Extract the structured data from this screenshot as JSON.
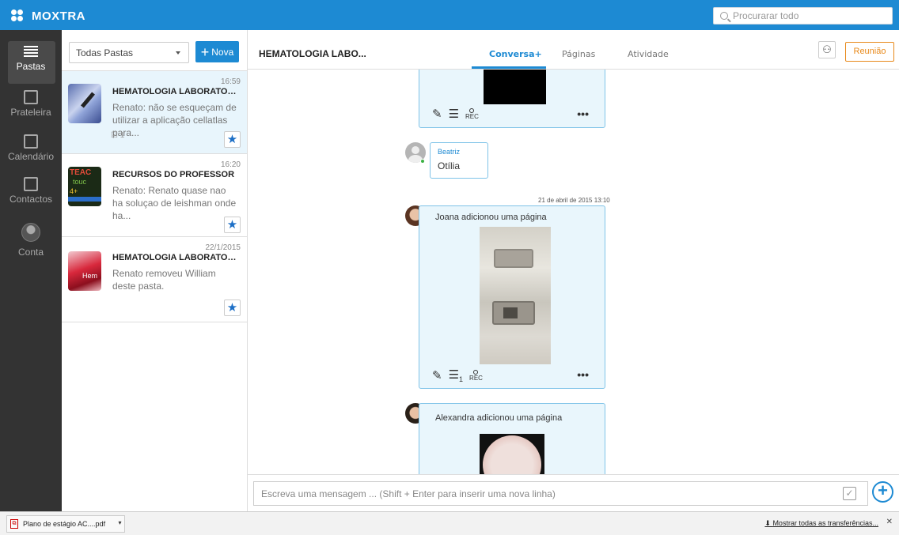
{
  "app": {
    "logo": "MOXTRA",
    "search_placeholder": "Procurarar todo"
  },
  "nav": {
    "items": [
      {
        "label": "Pastas",
        "icon": "list-icon",
        "active": true
      },
      {
        "label": "Prateleira",
        "icon": "shelf-icon"
      },
      {
        "label": "Calendário",
        "icon": "calendar-icon"
      },
      {
        "label": "Contactos",
        "icon": "contacts-icon"
      },
      {
        "label": "Conta",
        "icon": "account-avatar"
      }
    ]
  },
  "folders": {
    "filter": "Todas Pastas",
    "new_button": "Nova",
    "items": [
      {
        "time": "16:59",
        "title": "HEMATOLOGIA LABORATORI...",
        "preview": "Renato: não se esqueçam de utilizar a aplicação cellatlas para...",
        "count": "1",
        "active": true
      },
      {
        "time": "16:20",
        "title": "RECURSOS DO PROFESSOR",
        "preview": "Renato: Renato quase nao ha soluçao de leishman onde ha..."
      },
      {
        "time": "22/1/2015",
        "title": "HEMATOLOGIA LABORATORI...",
        "preview": "Renato removeu William deste pasta."
      }
    ]
  },
  "header": {
    "folder_title": "HEMATOLOGIA LABO...",
    "tabs": [
      "Conversa+",
      "Páginas",
      "Atividade"
    ],
    "meeting_button": "Reunião"
  },
  "chat": {
    "rec_label": "REC",
    "comment_count": "1",
    "messages": [
      {
        "sender": "Beatriz",
        "text": "Otília"
      },
      {
        "timestamp": "21 de abril de 2015 13:10",
        "text": "Joana adicionou uma página"
      },
      {
        "text": "Alexandra adicionou uma página"
      }
    ]
  },
  "composer": {
    "placeholder": "Escreva uma mensagem ... (Shift + Enter para inserir uma nova linha)"
  },
  "downloads": {
    "file": "Plano de estágio AC....pdf",
    "show_all": "Mostrar todas as transferências..."
  },
  "colors": {
    "brand": "#1d8ad3",
    "sidebar": "#333333",
    "accent": "#e8891a",
    "card_bg": "#e9f6fc"
  }
}
